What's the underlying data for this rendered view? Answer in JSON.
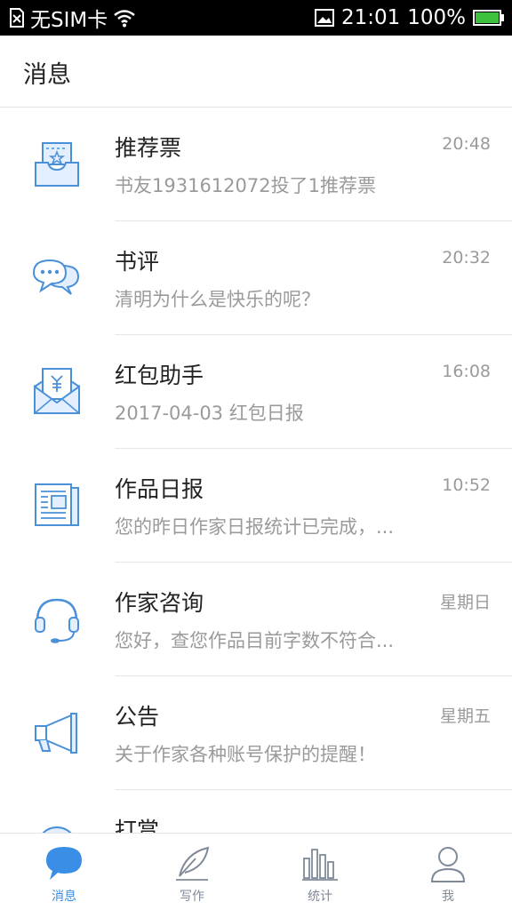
{
  "status_bar": {
    "sim_text": "无SIM卡",
    "time": "21:01",
    "battery": "100%"
  },
  "header": {
    "title": "消息"
  },
  "messages": [
    {
      "icon": "ticket-icon",
      "title": "推荐票",
      "time": "20:48",
      "preview": "书友1931612072投了1推荐票"
    },
    {
      "icon": "chat-bubbles-icon",
      "title": "书评",
      "time": "20:32",
      "preview": "清明为什么是快乐的呢？"
    },
    {
      "icon": "red-envelope-icon",
      "title": "红包助手",
      "time": "16:08",
      "preview": "2017-04-03 红包日报"
    },
    {
      "icon": "newspaper-icon",
      "title": "作品日报",
      "time": "10:52",
      "preview": "您的昨日作家日报统计已完成，..."
    },
    {
      "icon": "headset-icon",
      "title": "作家咨询",
      "time": "星期日",
      "preview": "您好，查您作品目前字数不符合..."
    },
    {
      "icon": "megaphone-icon",
      "title": "公告",
      "time": "星期五",
      "preview": "关于作家各种账号保护的提醒！"
    },
    {
      "icon": "reward-icon",
      "title": "打赏",
      "time": "",
      "preview": ""
    }
  ],
  "tabs": [
    {
      "label": "消息",
      "icon": "message-bubble-icon",
      "active": true
    },
    {
      "label": "写作",
      "icon": "quill-icon",
      "active": false
    },
    {
      "label": "统计",
      "icon": "bar-chart-icon",
      "active": false
    },
    {
      "label": "我",
      "icon": "person-icon",
      "active": false
    }
  ],
  "colors": {
    "accent": "#3a8ee6",
    "icon_stroke": "#4a90d9",
    "icon_fill": "#e3efff",
    "muted_text": "#9a9a9a",
    "tab_inactive": "#7f8a98"
  }
}
